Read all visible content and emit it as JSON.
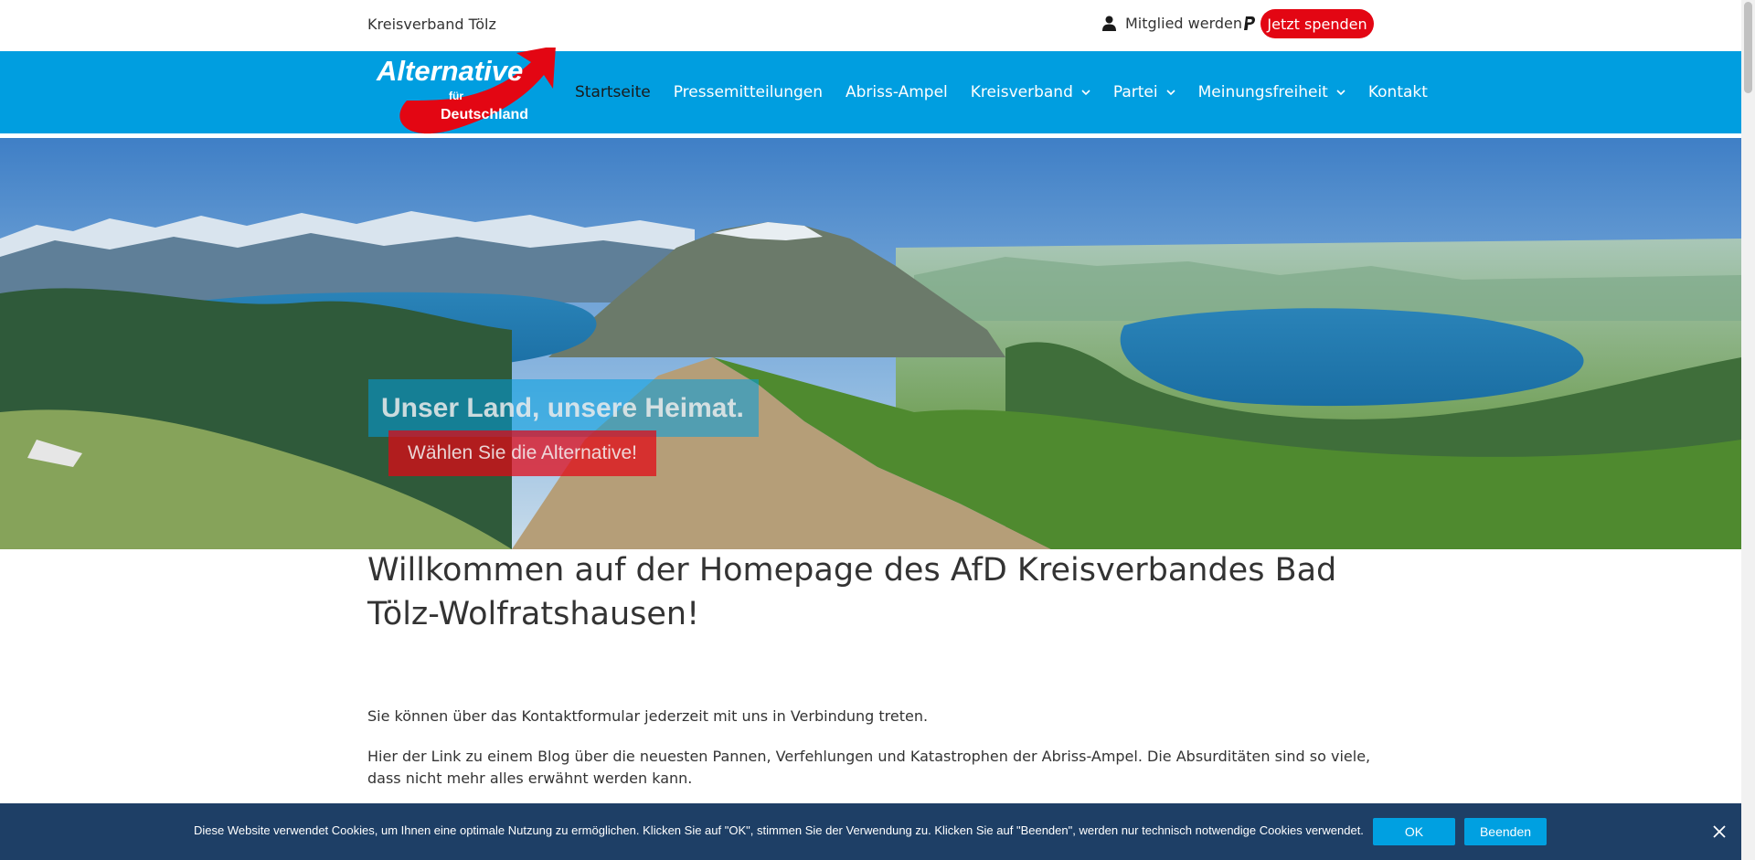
{
  "topbar": {
    "site_name": "Kreisverband Tölz",
    "member_label": "Mitglied werden",
    "donate_label": "Jetzt spenden"
  },
  "logo": {
    "line1": "Alternative",
    "line2": "für",
    "line3": "Deutschland"
  },
  "nav": {
    "items": [
      {
        "label": "Startseite",
        "active": true,
        "dropdown": false
      },
      {
        "label": "Pressemitteilungen",
        "active": false,
        "dropdown": false
      },
      {
        "label": "Abriss-Ampel",
        "active": false,
        "dropdown": false
      },
      {
        "label": "Kreisverband",
        "active": false,
        "dropdown": true
      },
      {
        "label": "Partei",
        "active": false,
        "dropdown": true
      },
      {
        "label": "Meinungsfreiheit",
        "active": false,
        "dropdown": true
      },
      {
        "label": "Kontakt",
        "active": false,
        "dropdown": false
      }
    ]
  },
  "hero": {
    "headline": "Unser Land, unsere Heimat.",
    "subline": "Wählen Sie die Alternative!"
  },
  "content": {
    "title": "Willkommen auf der Homepage des AfD Kreisverbandes Bad Tölz-Wolfratshausen!",
    "paragraph1": "Sie können über das Kontaktformular jederzeit mit uns in Verbindung treten.",
    "paragraph2": "Hier der Link zu einem Blog über die neuesten Pannen, Verfehlungen und Katastrophen der Abriss-Ampel. Die Absurditäten sind so viele, dass nicht mehr alles erwähnt werden kann."
  },
  "cookie": {
    "text": "Diese Website verwendet Cookies, um Ihnen eine optimale Nutzung zu ermöglichen. Klicken Sie auf \"OK\", stimmen Sie der Verwendung zu. Klicken Sie auf \"Beenden\", werden nur technisch notwendige Cookies verwendet.",
    "ok_label": "OK",
    "end_label": "Beenden"
  },
  "colors": {
    "brand_blue": "#009ee0",
    "brand_red": "#e30613",
    "cookie_bg": "#1e3f66"
  }
}
